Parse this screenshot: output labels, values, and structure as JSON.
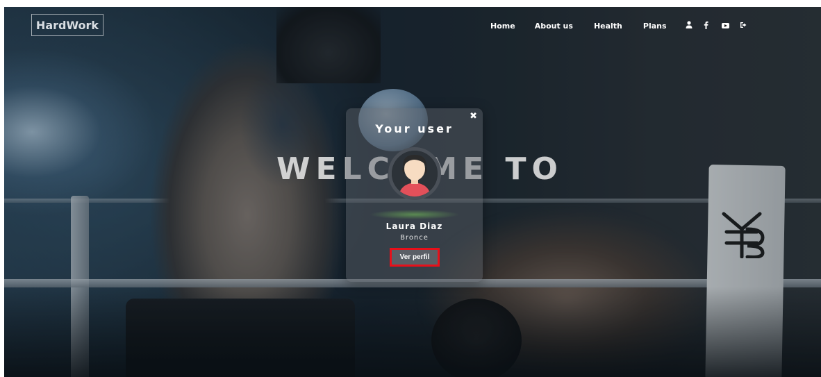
{
  "brand": {
    "name": "HardWork"
  },
  "nav": {
    "links": [
      "Home",
      "About us",
      "Health",
      "Plans"
    ],
    "icons": [
      "user-icon",
      "facebook-icon",
      "youtube-icon",
      "logout-icon"
    ]
  },
  "hero": {
    "title": "WELCOME TO"
  },
  "profile_card": {
    "close_glyph": "✖",
    "title": "Your user",
    "name": "Laura Diaz",
    "tier": "Bronce",
    "button_label": "Ver perfil"
  },
  "colors": {
    "highlight_border": "#e8101a",
    "avatar_shirt": "#e3505a",
    "avatar_skin": "#f7dcc2",
    "avatar_hair": "#2b2b2b"
  }
}
